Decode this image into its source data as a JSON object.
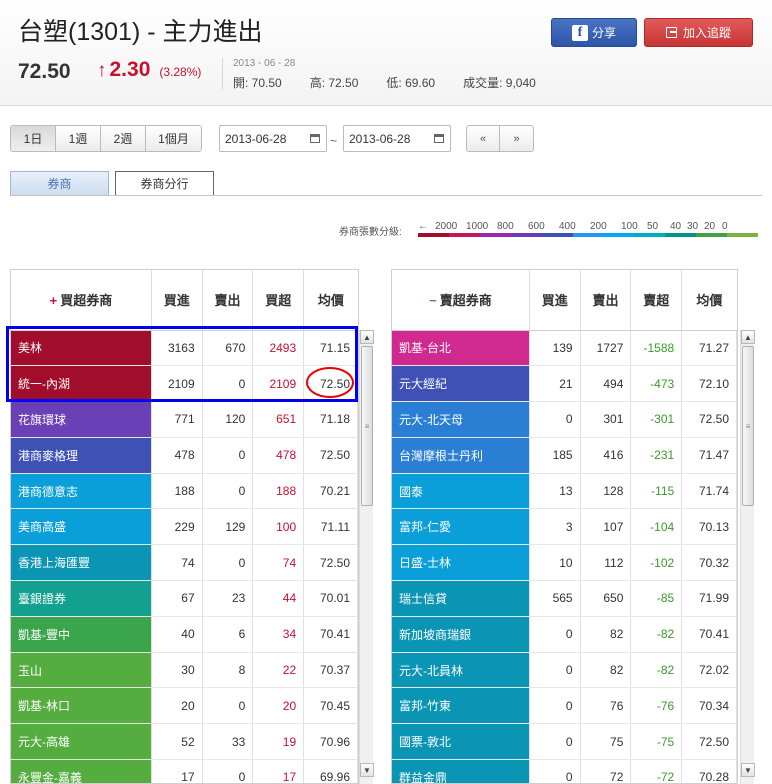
{
  "header": {
    "title": "台塑(1301) - 主力進出",
    "share_label": "分享",
    "follow_label": "加入追蹤",
    "price": "72.50",
    "change": "2.30",
    "change_pct": "(3.28%)",
    "date": "2013 - 06 - 28",
    "stats": [
      {
        "label": "開: ",
        "value": "70.50"
      },
      {
        "label": "高: ",
        "value": "72.50"
      },
      {
        "label": "低: ",
        "value": "69.60"
      },
      {
        "label": "成交量: ",
        "value": "9,040"
      }
    ]
  },
  "controls": {
    "periods": [
      "1日",
      "1週",
      "2週",
      "1個月"
    ],
    "active_period": "1日",
    "date_from": "2013-06-28",
    "date_to": "2013-06-28",
    "range_sep": "~",
    "prev_label": "«",
    "next_label": "»"
  },
  "tabs": [
    "券商",
    "券商分行"
  ],
  "active_tab": "券商分行",
  "legend": {
    "label": "券商張數分級:",
    "arrow": "←",
    "levels": [
      "2000",
      "1000",
      "800",
      "600",
      "400",
      "200",
      "100",
      "50",
      "40",
      "30",
      "20",
      "0"
    ],
    "colors": [
      "#a30d2c",
      "#c2185b",
      "#9c27b0",
      "#673ab7",
      "#3f51b5",
      "#2196f3",
      "#03a9f4",
      "#00acc1",
      "#009688",
      "#43a047",
      "#7cb342"
    ]
  },
  "buy_table": {
    "headers": [
      "買超券商",
      "買進",
      "賣出",
      "買超",
      "均價"
    ],
    "rows": [
      {
        "broker": "美林",
        "buy": "3163",
        "sell": "670",
        "net": "2493",
        "avg": "71.15",
        "color": "#a30d2c"
      },
      {
        "broker": "統一-內湖",
        "buy": "2109",
        "sell": "0",
        "net": "2109",
        "avg": "72.50",
        "color": "#a30d2c"
      },
      {
        "broker": "花旗環球",
        "buy": "771",
        "sell": "120",
        "net": "651",
        "avg": "71.18",
        "color": "#6b3fb5"
      },
      {
        "broker": "港商麥格理",
        "buy": "478",
        "sell": "0",
        "net": "478",
        "avg": "72.50",
        "color": "#3f51b5"
      },
      {
        "broker": "港商德意志",
        "buy": "188",
        "sell": "0",
        "net": "188",
        "avg": "70.21",
        "color": "#0a9fd8"
      },
      {
        "broker": "美商高盛",
        "buy": "229",
        "sell": "129",
        "net": "100",
        "avg": "71.11",
        "color": "#0a9fd8"
      },
      {
        "broker": "香港上海匯豐",
        "buy": "74",
        "sell": "0",
        "net": "74",
        "avg": "72.50",
        "color": "#0a95b5"
      },
      {
        "broker": "臺銀證券",
        "buy": "67",
        "sell": "23",
        "net": "44",
        "avg": "70.01",
        "color": "#12a08f"
      },
      {
        "broker": "凱基-豐中",
        "buy": "40",
        "sell": "6",
        "net": "34",
        "avg": "70.41",
        "color": "#3aa54a"
      },
      {
        "broker": "玉山",
        "buy": "30",
        "sell": "8",
        "net": "22",
        "avg": "70.37",
        "color": "#55ad3f"
      },
      {
        "broker": "凱基-林口",
        "buy": "20",
        "sell": "0",
        "net": "20",
        "avg": "70.45",
        "color": "#55ad3f"
      },
      {
        "broker": "元大-高雄",
        "buy": "52",
        "sell": "33",
        "net": "19",
        "avg": "70.96",
        "color": "#55ad3f"
      },
      {
        "broker": "永豐金-嘉義",
        "buy": "17",
        "sell": "0",
        "net": "17",
        "avg": "69.96",
        "color": "#55ad3f"
      }
    ]
  },
  "sell_table": {
    "headers": [
      "賣超券商",
      "買進",
      "賣出",
      "賣超",
      "均價"
    ],
    "rows": [
      {
        "broker": "凱基-台北",
        "buy": "139",
        "sell": "1727",
        "net": "-1588",
        "avg": "71.27",
        "color": "#d12a8e"
      },
      {
        "broker": "元大經紀",
        "buy": "21",
        "sell": "494",
        "net": "-473",
        "avg": "72.10",
        "color": "#3f51b5"
      },
      {
        "broker": "元大-北天母",
        "buy": "0",
        "sell": "301",
        "net": "-301",
        "avg": "72.50",
        "color": "#2a7fd4"
      },
      {
        "broker": "台灣摩根士丹利",
        "buy": "185",
        "sell": "416",
        "net": "-231",
        "avg": "71.47",
        "color": "#2a7fd4"
      },
      {
        "broker": "國泰",
        "buy": "13",
        "sell": "128",
        "net": "-115",
        "avg": "71.74",
        "color": "#0a9fd8"
      },
      {
        "broker": "富邦-仁愛",
        "buy": "3",
        "sell": "107",
        "net": "-104",
        "avg": "70.13",
        "color": "#0a9fd8"
      },
      {
        "broker": "日盛-士林",
        "buy": "10",
        "sell": "112",
        "net": "-102",
        "avg": "70.32",
        "color": "#0a9fd8"
      },
      {
        "broker": "瑞士信貸",
        "buy": "565",
        "sell": "650",
        "net": "-85",
        "avg": "71.99",
        "color": "#0a95b5"
      },
      {
        "broker": "新加坡商瑞銀",
        "buy": "0",
        "sell": "82",
        "net": "-82",
        "avg": "70.41",
        "color": "#0a95b5"
      },
      {
        "broker": "元大-北員林",
        "buy": "0",
        "sell": "82",
        "net": "-82",
        "avg": "72.02",
        "color": "#0a95b5"
      },
      {
        "broker": "富邦-竹東",
        "buy": "0",
        "sell": "76",
        "net": "-76",
        "avg": "70.34",
        "color": "#0a95b5"
      },
      {
        "broker": "國票-敦北",
        "buy": "0",
        "sell": "75",
        "net": "-75",
        "avg": "72.50",
        "color": "#0a95b5"
      },
      {
        "broker": "群益金鼎",
        "buy": "0",
        "sell": "72",
        "net": "-72",
        "avg": "70.28",
        "color": "#0a95b5"
      }
    ]
  }
}
